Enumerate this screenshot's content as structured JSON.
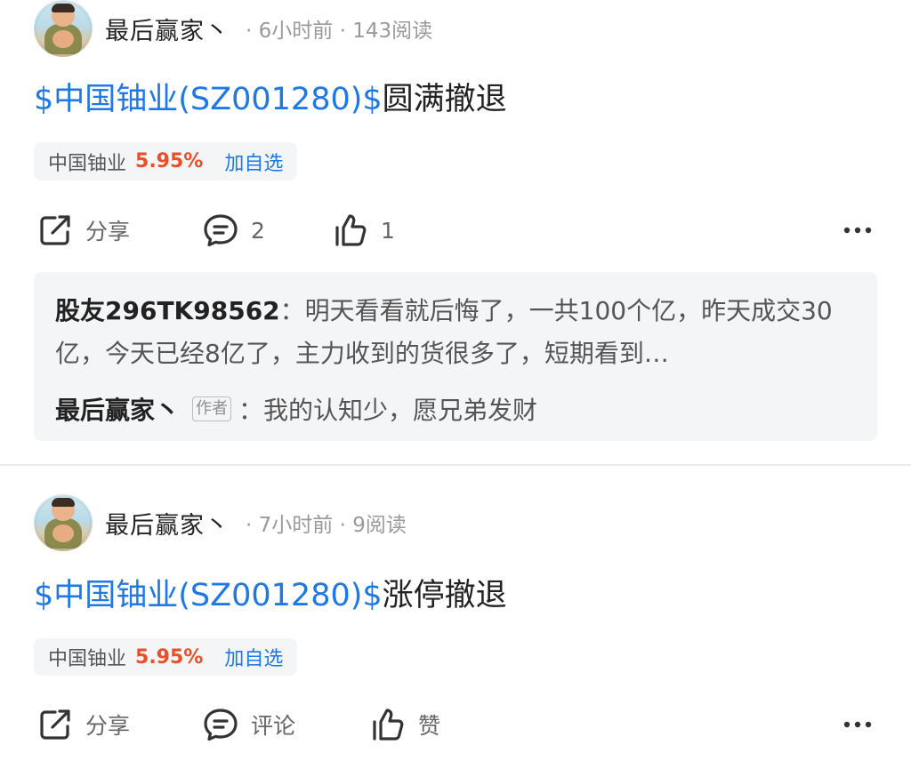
{
  "posts": [
    {
      "author": "最后赢家丶",
      "meta": "· 6小时前 · 143阅读",
      "title_link": "$中国铀业(SZ001280)$",
      "title_rest": "圆满撤退",
      "stock": {
        "name": "中国铀业",
        "change": "5.95%",
        "add_label": "加自选"
      },
      "actions": {
        "share_label": "分享",
        "comment_label": "2",
        "like_label": "1"
      },
      "replies": [
        {
          "user": "股友296TK98562",
          "text": "：明天看看就后悔了，一共100个亿，昨天成交30亿，今天已经8亿了，主力收到的货很多了，短期看到…"
        },
        {
          "user": "最后赢家丶",
          "tag": "作者",
          "text": "：我的认知少，愿兄弟发财"
        }
      ]
    },
    {
      "author": "最后赢家丶",
      "meta": "· 7小时前 · 9阅读",
      "title_link": "$中国铀业(SZ001280)$",
      "title_rest": "涨停撤退",
      "stock": {
        "name": "中国铀业",
        "change": "5.95%",
        "add_label": "加自选"
      },
      "actions": {
        "share_label": "分享",
        "comment_label": "评论",
        "like_label": "赞"
      }
    }
  ],
  "icons": [
    "share-icon",
    "comment-icon",
    "like-icon",
    "more-icon"
  ],
  "colors": {
    "link": "#1e78e6",
    "up": "#ea4f28",
    "chip_bg": "#f4f5f7",
    "muted": "#9a9a9a"
  }
}
